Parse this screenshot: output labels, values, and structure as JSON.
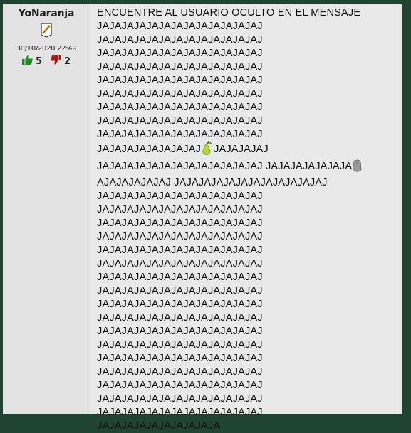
{
  "post": {
    "author": {
      "username": "YoNaranja",
      "badge_icon": "scroll-badge-icon",
      "date": "30/10/2020 22:49",
      "upvotes": "5",
      "downvotes": "2"
    },
    "message": {
      "title": "ENCUENTRE AL USUARIO OCULTO EN EL MENSAJE",
      "lines": [
        "JAJAJAJAJAJAJAJAJAJAJAJAJAJ",
        "JAJAJAJAJAJAJAJAJAJAJAJAJAJ",
        "JAJAJAJAJAJAJAJAJAJAJAJAJAJ",
        "JAJAJAJAJAJAJAJAJAJAJAJAJAJ",
        "JAJAJAJAJAJAJAJAJAJAJAJAJAJ",
        "JAJAJAJAJAJAJAJAJAJAJAJAJAJ",
        "JAJAJAJAJAJAJAJAJAJAJAJAJAJ",
        "JAJAJAJAJAJAJAJAJAJAJAJAJAJ",
        "JAJAJAJAJAJAJAJAJAJAJAJAJAJ"
      ],
      "pear_line": {
        "before": "JAJAJAJAJAJAJAJAJ",
        "icon": "pear-emoji-icon",
        "after": "JAJAJAJAJ"
      },
      "rock_line": {
        "before": "JAJAJAJAJAJAJAJAJAJAJAJAJAJ JAJAJAJAJAJAJA",
        "icon": "rock-emoji-icon"
      },
      "line_after_rock": "AJAJAJAJAJAJ JAJAJAJAJAJAJAJAJAJAJAJAJ",
      "lines_after": [
        "JAJAJAJAJAJAJAJAJAJAJAJAJAJ",
        "JAJAJAJAJAJAJAJAJAJAJAJAJAJ",
        "JAJAJAJAJAJAJAJAJAJAJAJAJAJ",
        "JAJAJAJAJAJAJAJAJAJAJAJAJAJ",
        "JAJAJAJAJAJAJAJAJAJAJAJAJAJ",
        "JAJAJAJAJAJAJAJAJAJAJAJAJAJ",
        "JAJAJAJAJAJAJAJAJAJAJAJAJAJ",
        "JAJAJAJAJAJAJAJAJAJAJAJAJAJ",
        "JAJAJAJAJAJAJAJAJAJAJAJAJAJ",
        "JAJAJAJAJAJAJAJAJAJAJAJAJAJ",
        "JAJAJAJAJAJAJAJAJAJAJAJAJAJ",
        "JAJAJAJAJAJAJAJAJAJAJAJAJAJ",
        "JAJAJAJAJAJAJAJAJAJAJAJAJAJ",
        "JAJAJAJAJAJAJAJAJAJAJAJAJAJ",
        "JAJAJAJAJAJAJAJAJAJAJAJAJAJ",
        "JAJAJAJAJAJAJAJAJAJAJAJAJAJ",
        "JAJAJAJAJAJAJAJAJAJAJAJAJAJ"
      ],
      "last_line": "JAJAJAJAJAJAJAJAJAJA"
    }
  },
  "colors": {
    "background": "#1f4531",
    "post_bg": "#e9e9e9",
    "author_bg": "#e3e3e3",
    "upvote": "#1f8a1f",
    "downvote": "#a31818"
  }
}
